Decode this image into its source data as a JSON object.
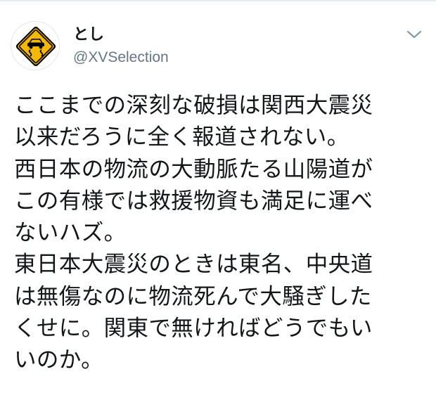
{
  "tweet": {
    "author": {
      "display_name": "とし",
      "handle": "@XVSelection",
      "avatar_icon": "slippery-road-sign-icon"
    },
    "menu_icon": "chevron-down-icon",
    "text_lines": [
      "ここまでの深刻な破損は関西大震災",
      "以来だろうに全く報道されない。",
      "西日本の物流の大動脈たる山陽道が",
      "この有様では救援物資も満足に運べ",
      "ないハズ。",
      "東日本大震災のときは東名、中央道",
      "は無傷なのに物流死んで大騒ぎした",
      "くせに。関東で無ければどうでもい",
      "いのか。"
    ]
  },
  "colors": {
    "text_primary": "#14171a",
    "text_secondary": "#657786",
    "sign_yellow": "#f5b800",
    "sign_black": "#000000",
    "border": "#e6ecf0"
  }
}
